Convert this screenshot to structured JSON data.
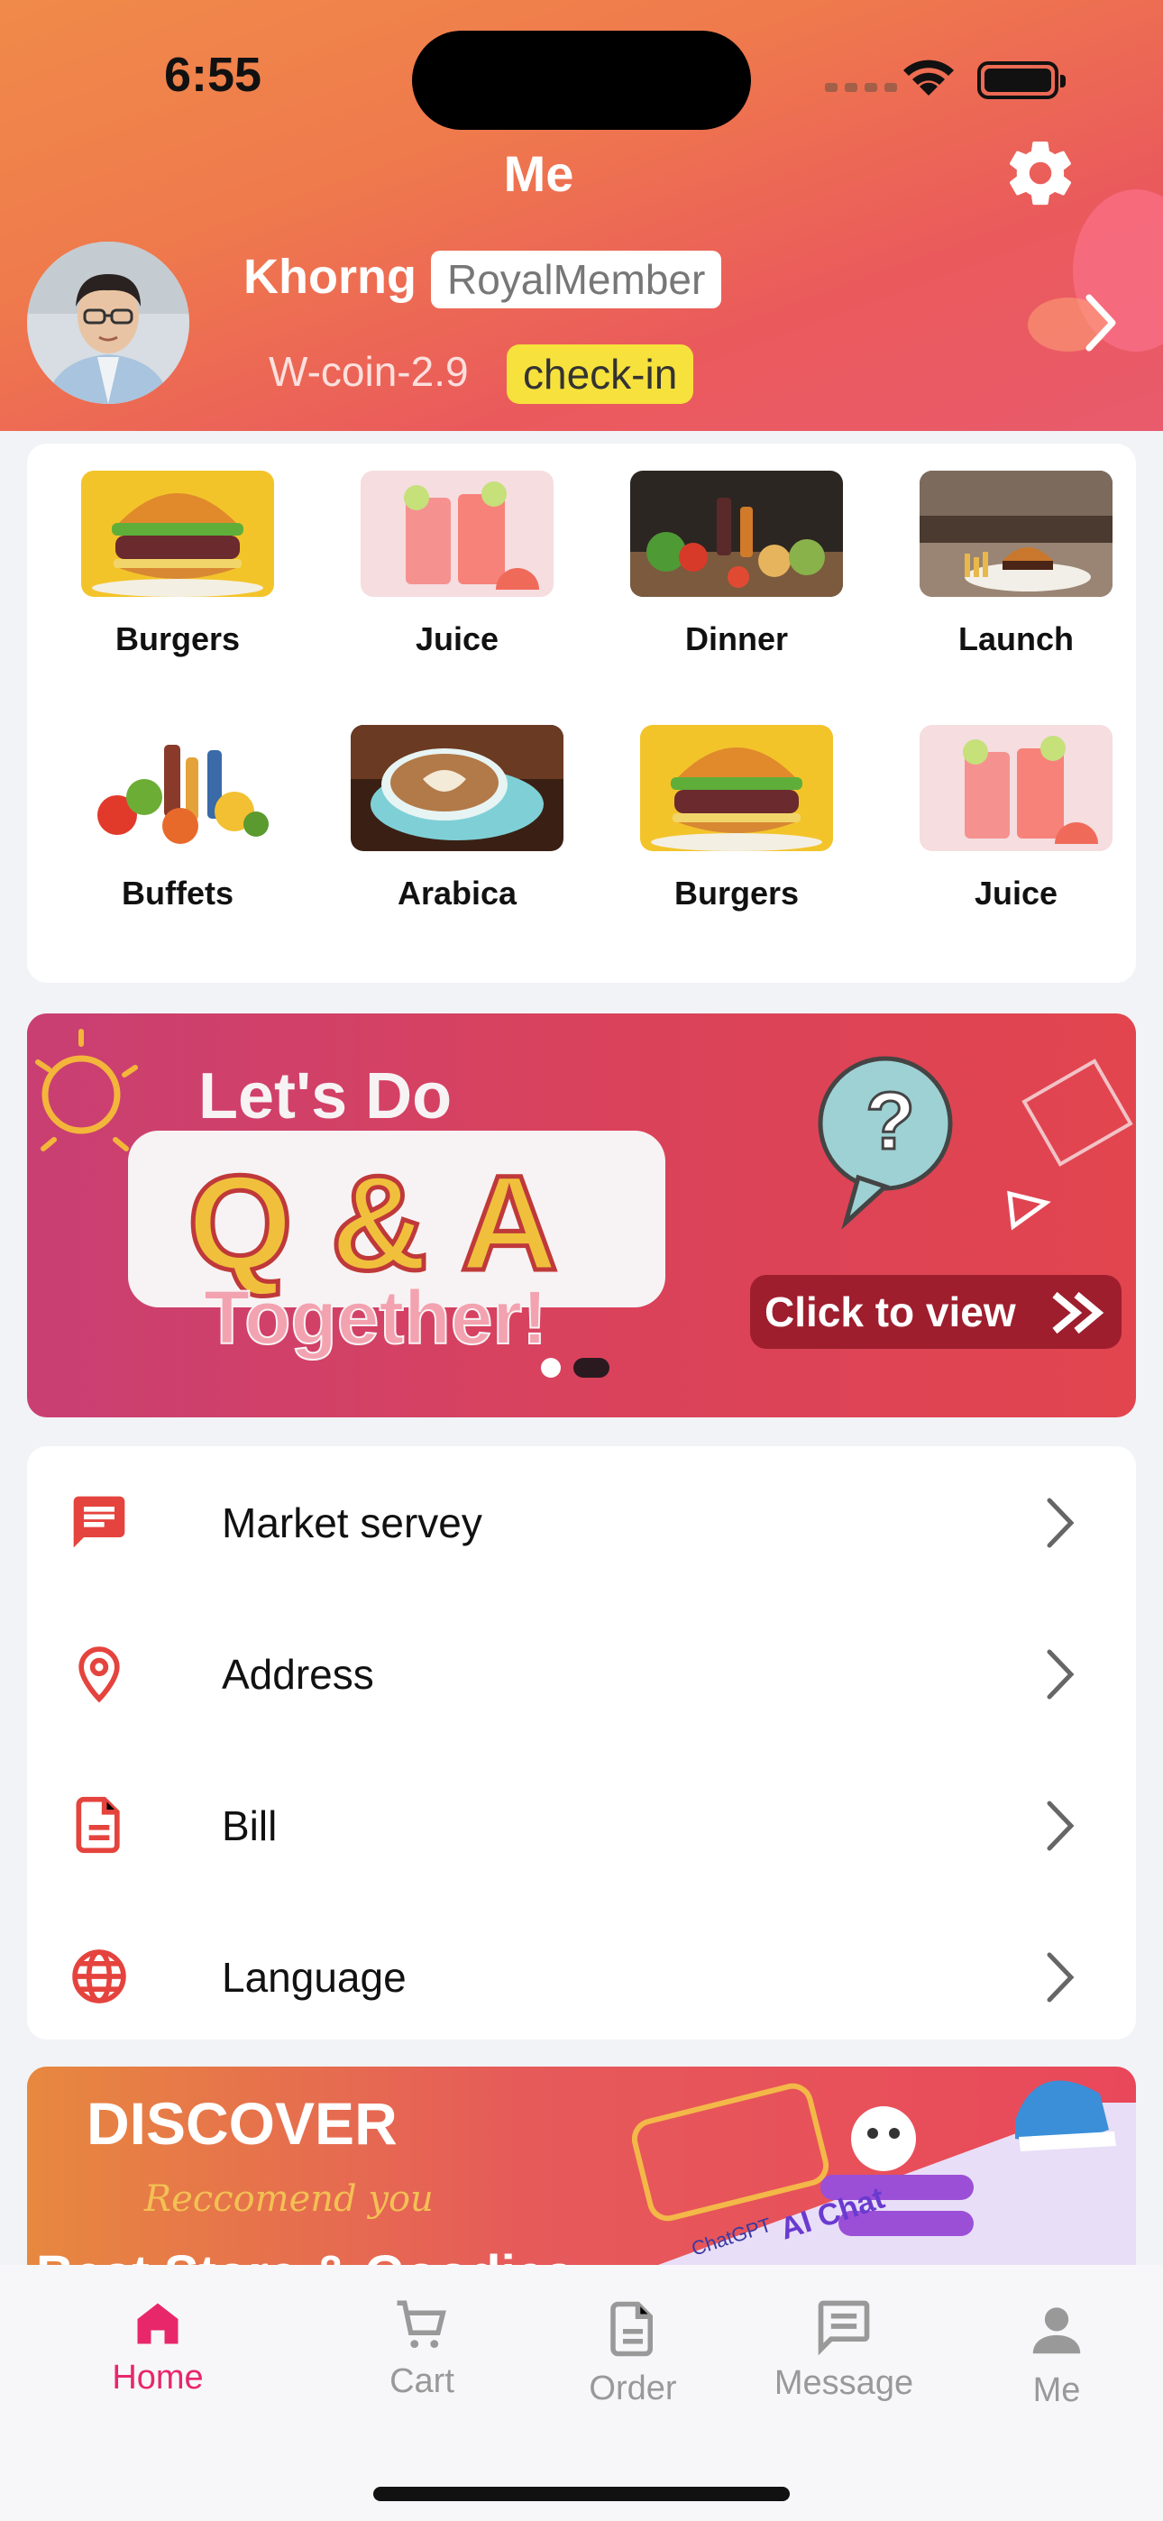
{
  "status": {
    "time": "6:55"
  },
  "header": {
    "title": "Me",
    "user_name": "Khorng",
    "member_badge": "RoyalMember",
    "coin_text": "W-coin-2.9",
    "checkin_label": "check-in"
  },
  "categories": [
    {
      "label": "Burgers"
    },
    {
      "label": "Juice"
    },
    {
      "label": "Dinner"
    },
    {
      "label": "Launch"
    },
    {
      "label": "Buffets"
    },
    {
      "label": "Arabica"
    },
    {
      "label": "Burgers"
    },
    {
      "label": "Juice"
    }
  ],
  "banner": {
    "line1": "Let's Do",
    "line2": "Q & A",
    "line3": "Together!",
    "cta": "Click to view"
  },
  "menu": [
    {
      "label": "Market servey",
      "icon": "message-icon"
    },
    {
      "label": "Address",
      "icon": "location-pin-icon"
    },
    {
      "label": "Bill",
      "icon": "document-icon"
    },
    {
      "label": "Language",
      "icon": "globe-icon"
    }
  ],
  "discover": {
    "title": "DISCOVER",
    "subtitle": "Reccomend you",
    "bottom_text": "Best Store & Goodies",
    "tag1": "ChatGPT",
    "tag2": "AI Chat"
  },
  "tabs": [
    {
      "label": "Home",
      "icon": "home-icon",
      "active": true
    },
    {
      "label": "Cart",
      "icon": "cart-icon",
      "active": false
    },
    {
      "label": "Order",
      "icon": "order-icon",
      "active": false
    },
    {
      "label": "Message",
      "icon": "message-icon",
      "active": false
    },
    {
      "label": "Me",
      "icon": "person-icon",
      "active": false
    }
  ],
  "colors": {
    "accent": "#e8276b",
    "menu_icon": "#e5433d",
    "checkin_bg": "#f7e13c"
  }
}
